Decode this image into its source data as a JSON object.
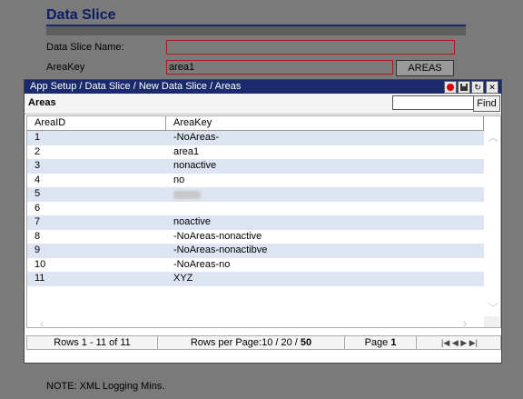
{
  "page": {
    "title": "Data Slice",
    "note": "NOTE: XML Logging Mins."
  },
  "form": {
    "data_slice_name_label": "Data Slice Name:",
    "data_slice_name_value": "",
    "areakey_label": "AreaKey",
    "areakey_value": "area1",
    "areas_button": "AREAS"
  },
  "dialog": {
    "title": "App Setup / Data Slice / New Data Slice / Areas",
    "heading": "Areas",
    "search_value": "",
    "find_button": "Find",
    "window_buttons": [
      "record-icon",
      "save-icon",
      "refresh-icon",
      "close-icon"
    ],
    "columns": [
      "AreaID",
      "AreaKey"
    ],
    "rows": [
      {
        "id": "1",
        "key": "-NoAreas-"
      },
      {
        "id": "2",
        "key": "area1"
      },
      {
        "id": "3",
        "key": "nonactive"
      },
      {
        "id": "4",
        "key": "no"
      },
      {
        "id": "5",
        "key": "(blurred)"
      },
      {
        "id": "6",
        "key": ""
      },
      {
        "id": "7",
        "key": "noactive"
      },
      {
        "id": "8",
        "key": "-NoAreas-nonactive"
      },
      {
        "id": "9",
        "key": "-NoAreas-nonactibve"
      },
      {
        "id": "10",
        "key": "-NoAreas-no"
      },
      {
        "id": "11",
        "key": "XYZ"
      }
    ],
    "pager": {
      "rows_info": "Rows 1 - 11 of 11",
      "rows_per_page_prefix": "Rows per Page:",
      "rows_per_page_options": "10 / 20 / ",
      "rows_per_page_selected": "50",
      "page_label": "Page ",
      "page_number": "1"
    }
  },
  "colors": {
    "titlebar": "#1a2a6c",
    "row_alt": "#dde4f2",
    "required_border": "#b01818",
    "record_button": "#e00000"
  }
}
